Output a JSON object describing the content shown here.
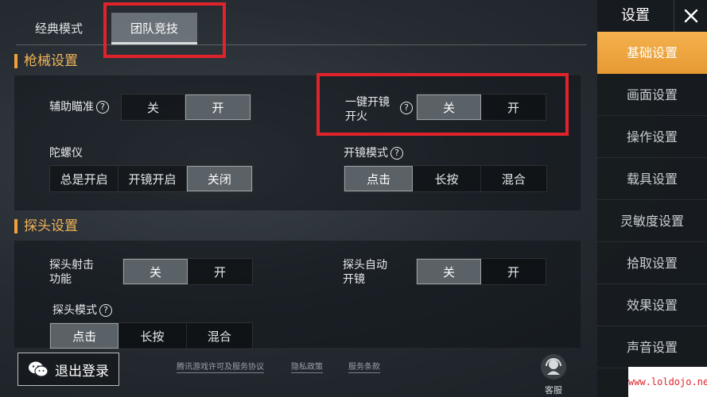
{
  "mode_tabs": [
    "经典模式",
    "团队竞技"
  ],
  "sections": {
    "gun": {
      "title": "枪械设置",
      "aim_assist": {
        "label": "辅助瞄准",
        "options": [
          "关",
          "开"
        ],
        "selected": 1
      },
      "scope_fire": {
        "label_line1": "一键开镜",
        "label_line2": "开火",
        "options": [
          "关",
          "开"
        ],
        "selected": 0
      },
      "gyro": {
        "label": "陀螺仪",
        "options": [
          "总是开启",
          "开镜开启",
          "关闭"
        ],
        "selected": 2
      },
      "scope_mode": {
        "label": "开镜模式",
        "options": [
          "点击",
          "长按",
          "混合"
        ],
        "selected": 0
      }
    },
    "peek": {
      "title": "探头设置",
      "peek_fire": {
        "label_line1": "探头射击",
        "label_line2": "功能",
        "options": [
          "关",
          "开"
        ],
        "selected": 0
      },
      "peek_auto_scope": {
        "label_line1": "探头自动",
        "label_line2": "开镜",
        "options": [
          "关",
          "开"
        ],
        "selected": 0
      },
      "peek_mode": {
        "label": "探头模式",
        "options": [
          "点击",
          "长按",
          "混合"
        ],
        "selected": 0
      }
    }
  },
  "sidebar": {
    "title": "设置",
    "items": [
      "基础设置",
      "画面设置",
      "操作设置",
      "载具设置",
      "灵敏度设置",
      "拾取设置",
      "效果设置",
      "声音设置"
    ],
    "active": 0
  },
  "footer": {
    "logout": "退出登录",
    "links": [
      "腾讯游戏许可及服务协议",
      "隐私政策",
      "服务条款"
    ],
    "customer_service": "客服"
  },
  "watermark": "www.loldojo.net",
  "colors": {
    "accent": "#e79a33",
    "highlight_box": "#e0232b",
    "section_title": "#f0b45a"
  },
  "icons": [
    "help-icon",
    "close-icon",
    "wechat-icon",
    "customer-service-icon"
  ]
}
